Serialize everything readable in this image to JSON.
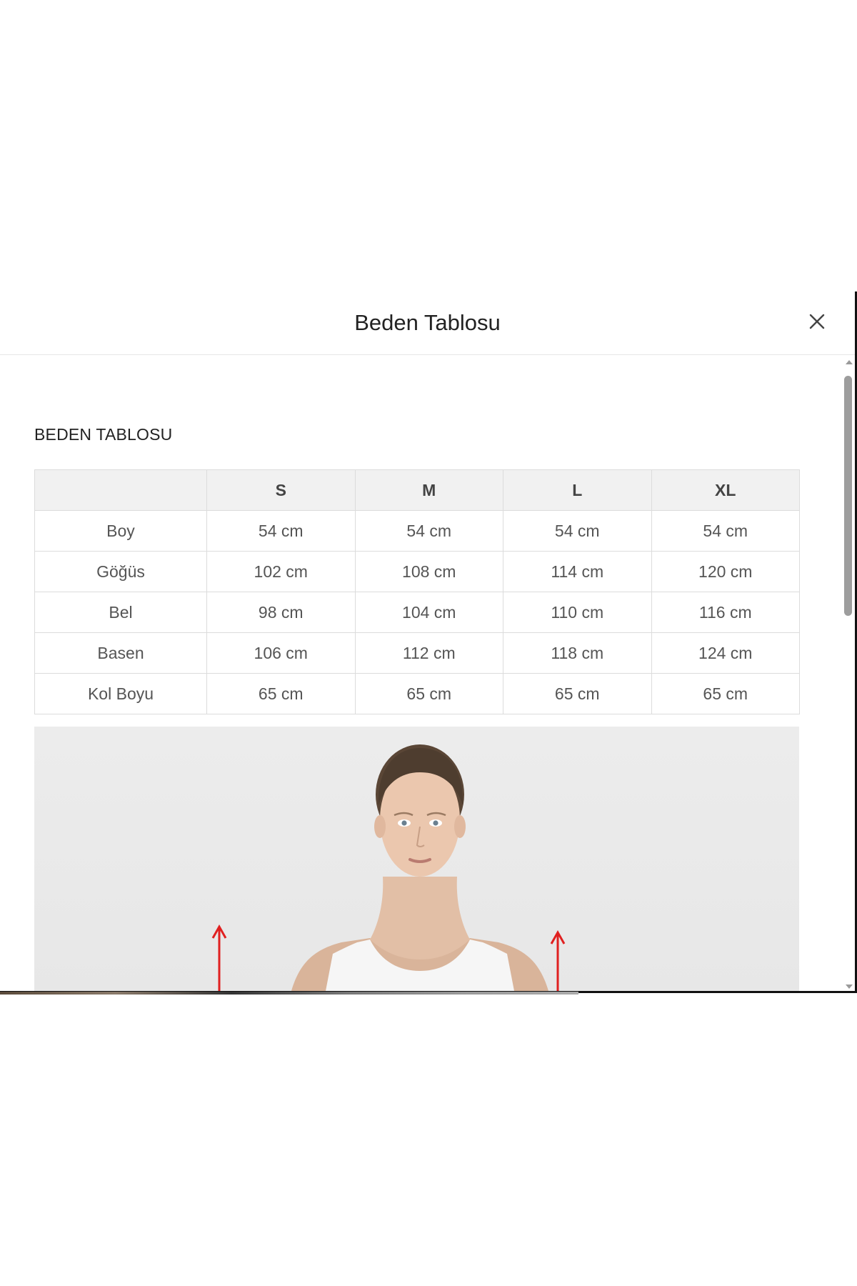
{
  "modal": {
    "title": "Beden Tablosu",
    "close_icon": "close-icon"
  },
  "content": {
    "section_title": "BEDEN TABLOSU",
    "table": {
      "headers": [
        "",
        "S",
        "M",
        "L",
        "XL"
      ],
      "rows": [
        [
          "Boy",
          "54 cm",
          "54 cm",
          "54 cm",
          "54 cm"
        ],
        [
          "Göğüs",
          "102 cm",
          "108 cm",
          "114 cm",
          "120 cm"
        ],
        [
          "Bel",
          "98 cm",
          "104 cm",
          "110 cm",
          "116 cm"
        ],
        [
          "Basen",
          "106 cm",
          "112 cm",
          "118 cm",
          "124 cm"
        ],
        [
          "Kol Boyu",
          "65 cm",
          "65 cm",
          "65 cm",
          "65 cm"
        ]
      ]
    }
  },
  "colors": {
    "arrow": "#e02020",
    "header_bg": "#f1f1f1",
    "border": "#dcdcdc",
    "text": "#555555"
  }
}
